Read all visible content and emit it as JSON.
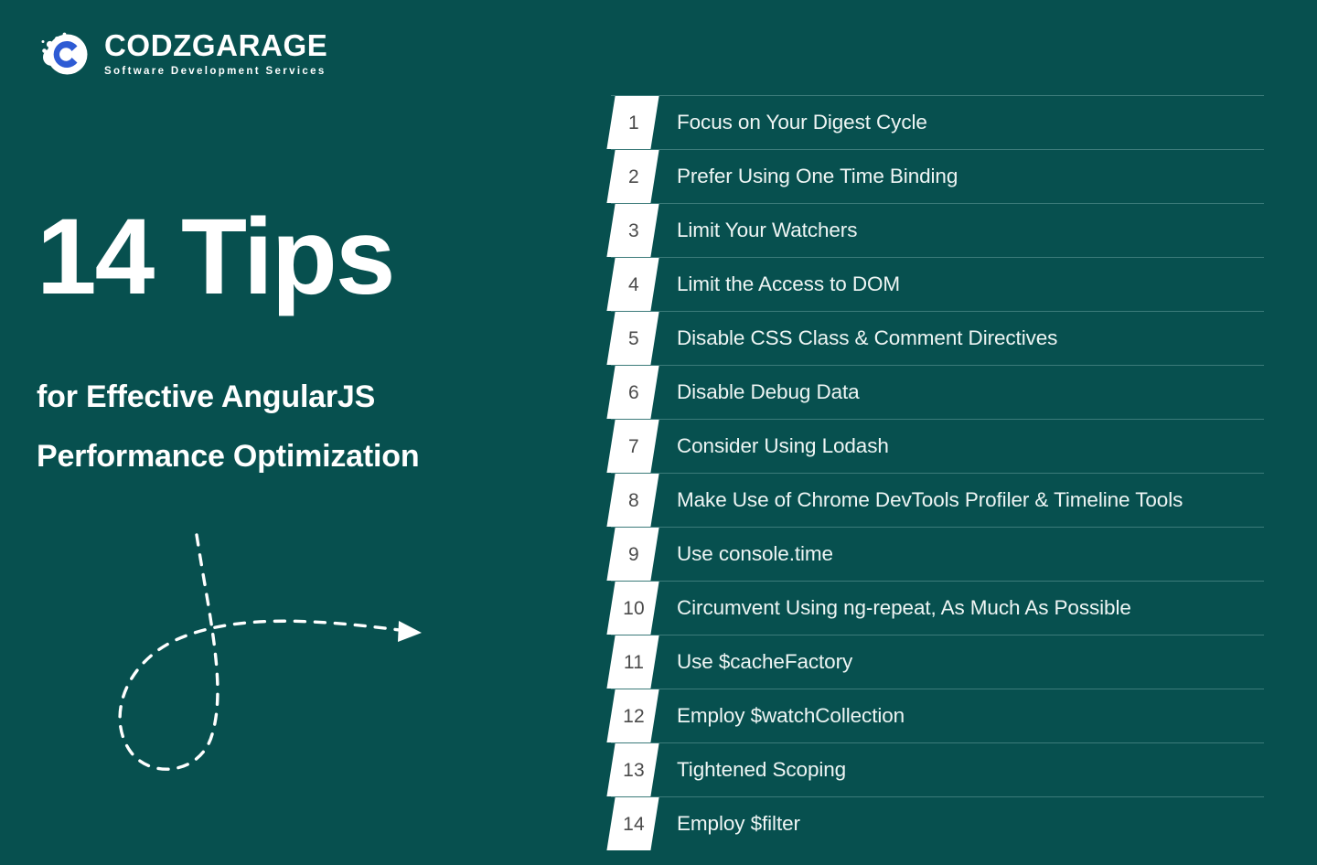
{
  "brand": {
    "name": "CODZGARAGE",
    "tagline": "Software Development Services",
    "logo_icon": "codzgarage-c-bubble-logo",
    "logo_mark_color": "#2e5bd4",
    "logo_blob_color": "#ffffff"
  },
  "hero": {
    "title": "14 Tips",
    "subtitle_line1": "for Effective AngularJS",
    "subtitle_line2": "Performance Optimization"
  },
  "decoration": {
    "arrow_icon": "dashed-looping-arrow",
    "color": "#ffffff"
  },
  "theme": {
    "background": "#07504F",
    "text": "#ffffff",
    "list_text": "#eef5f4",
    "divider": "#3c7b7a",
    "badge_background": "#ffffff",
    "badge_number": "#4b4b4b"
  },
  "tips": [
    {
      "number": "1",
      "label": "Focus on Your Digest Cycle"
    },
    {
      "number": "2",
      "label": "Prefer Using One Time Binding"
    },
    {
      "number": "3",
      "label": "Limit Your Watchers"
    },
    {
      "number": "4",
      "label": "Limit the Access to DOM"
    },
    {
      "number": "5",
      "label": "Disable CSS Class & Comment Directives"
    },
    {
      "number": "6",
      "label": "Disable Debug Data"
    },
    {
      "number": "7",
      "label": "Consider Using Lodash"
    },
    {
      "number": "8",
      "label": "Make Use of Chrome DevTools Profiler & Timeline Tools"
    },
    {
      "number": "9",
      "label": "Use console.time"
    },
    {
      "number": "10",
      "label": "Circumvent Using ng-repeat, As Much As Possible"
    },
    {
      "number": "11",
      "label": "Use $cacheFactory"
    },
    {
      "number": "12",
      "label": "Employ $watchCollection"
    },
    {
      "number": "13",
      "label": "Tightened Scoping"
    },
    {
      "number": "14",
      "label": "Employ $filter"
    }
  ]
}
